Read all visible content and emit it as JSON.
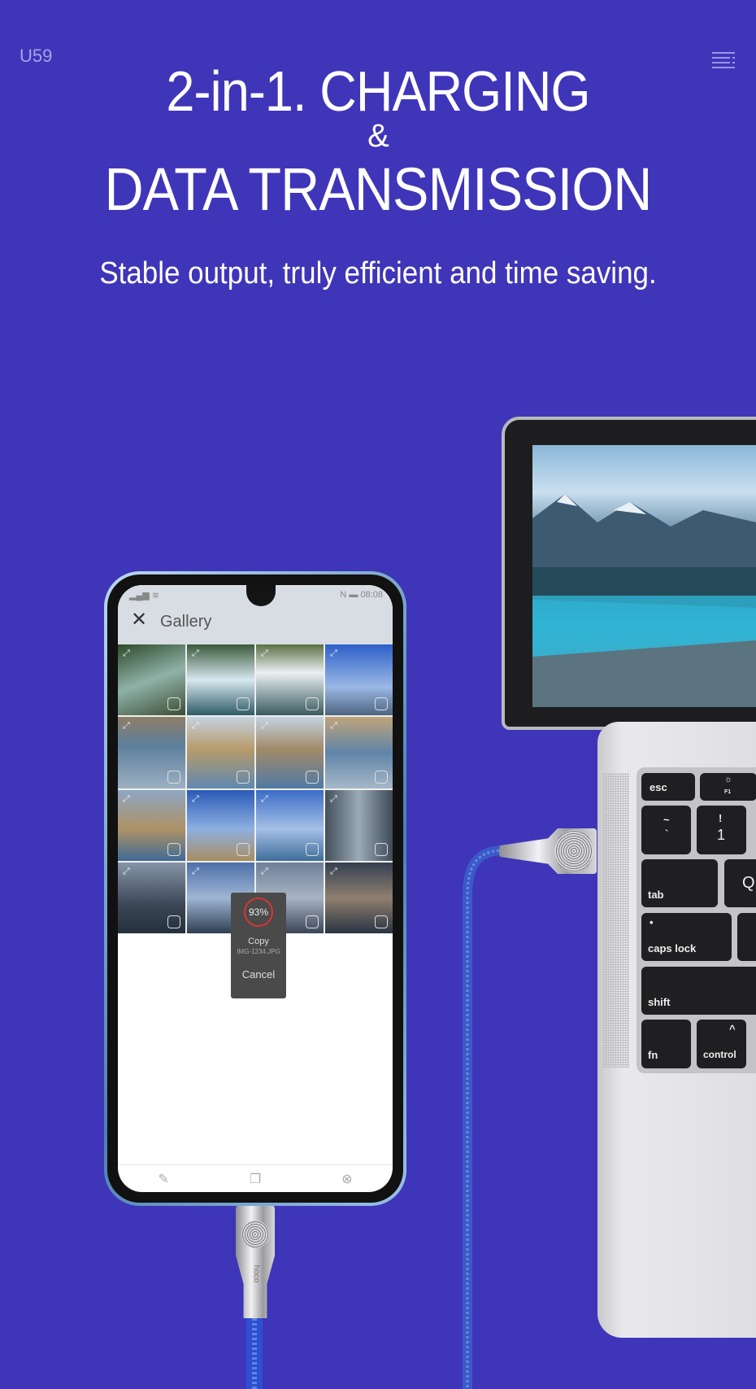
{
  "header": {
    "model": "U59",
    "menu_icon": "menu-icon"
  },
  "headline": {
    "line1": "2-in-1. CHARGING",
    "ampersand": "&",
    "line2": "DATA TRANSMISSION",
    "subtitle": "Stable output, truly efficient and time saving."
  },
  "colors": {
    "background": "#3f35b9",
    "title": "#ffffff",
    "progress_ring": "#dd3333"
  },
  "phone": {
    "status": {
      "time": "08:08",
      "signal": "signal-icon",
      "wifi": "wifi-icon",
      "nfc": "N",
      "battery": "battery-icon"
    },
    "gallery_title": "Gallery",
    "copy_dialog": {
      "progress": "93%",
      "progress_value": 93,
      "action": "Copy",
      "filename": "IMG-1234.JPG",
      "cancel": "Cancel"
    },
    "bottom_bar": [
      "edit-icon",
      "copy-icon",
      "close-circle-icon"
    ]
  },
  "cable_brand": "hoco",
  "keyboard": {
    "esc": "esc",
    "f1": "F1",
    "tilde": "~",
    "backtick": "`",
    "exclaim": "!",
    "one": "1",
    "tab": "tab",
    "q": "Q",
    "caps": "caps lock",
    "shift": "shift",
    "fn": "fn",
    "control": "control",
    "control_symbol": "^"
  }
}
